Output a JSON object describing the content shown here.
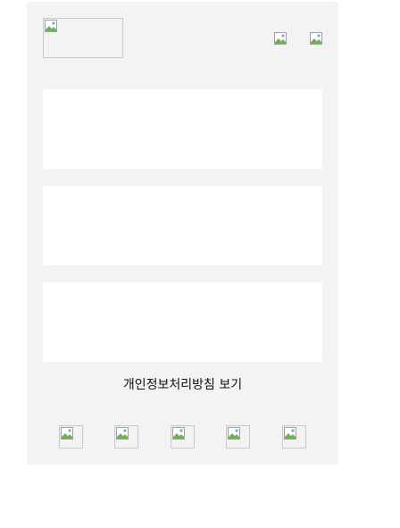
{
  "header": {
    "logo_icon": "broken-image-icon",
    "icons": [
      "broken-image-icon",
      "broken-image-icon"
    ]
  },
  "cards": [
    "",
    "",
    ""
  ],
  "footer": {
    "privacy_link_label": "개인정보처리방침 보기",
    "nav_icons": [
      "broken-image-icon",
      "broken-image-icon",
      "broken-image-icon",
      "broken-image-icon",
      "broken-image-icon"
    ]
  }
}
